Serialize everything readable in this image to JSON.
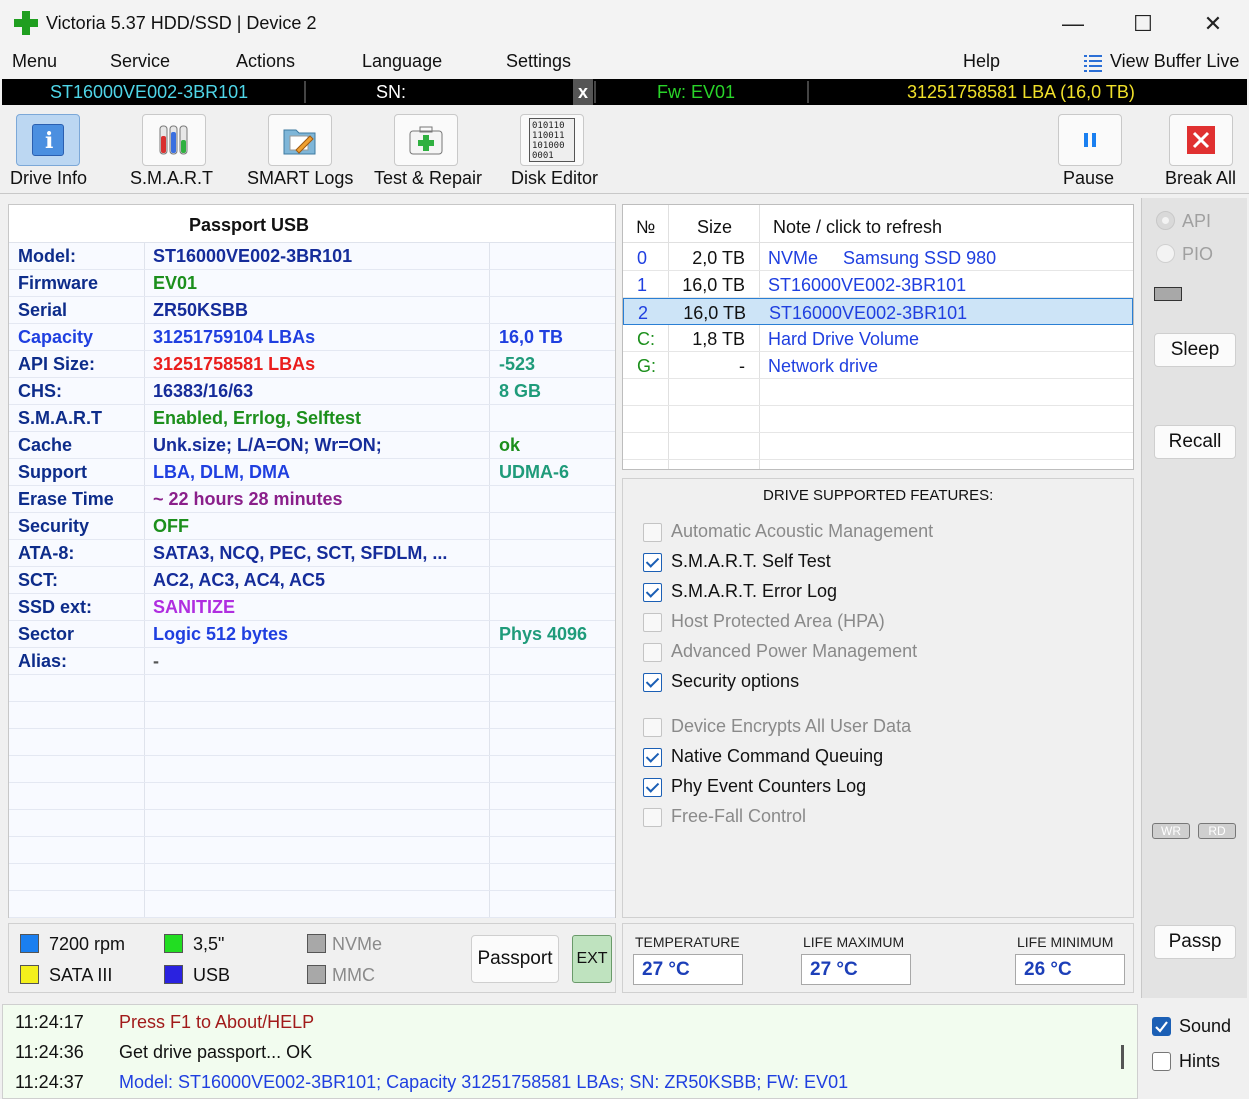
{
  "window": {
    "title": "Victoria 5.37 HDD/SSD | Device 2",
    "minimize": "—",
    "maximize": "☐",
    "close": "✕"
  },
  "menu": {
    "items": [
      "Menu",
      "Service",
      "Actions",
      "Language",
      "Settings",
      "Help"
    ],
    "view_buffer": "View Buffer Live"
  },
  "drive_strip": {
    "model": "ST16000VE002-3BR101",
    "sn_label": "SN:",
    "x_label": "x",
    "fw": "Fw: EV01",
    "lba": "31251758581 LBA (16,0 TB)",
    "colors": {
      "model": "#4fd6e8",
      "fw": "#29d429",
      "lba": "#f0e02a"
    }
  },
  "toolbar": {
    "drive_info": "Drive Info",
    "smart": "S.M.A.R.T",
    "smart_logs": "SMART Logs",
    "test_repair": "Test & Repair",
    "disk_editor": "Disk Editor",
    "pause": "Pause",
    "break_all": "Break All",
    "disk_editor_icon_text": "010110 110011 101000 0001"
  },
  "passport": {
    "header": "Passport USB",
    "rows": [
      {
        "key": "Model:",
        "value": "ST16000VE002-3BR101",
        "extra": "",
        "vcolor": "#152c9a",
        "xcolor": "#152c9a"
      },
      {
        "key": "Firmware",
        "value": "EV01",
        "extra": "",
        "vcolor": "#1c8f1c",
        "xcolor": "#152c9a"
      },
      {
        "key": "Serial",
        "value": "ZR50KSBB",
        "extra": "",
        "vcolor": "#152c9a",
        "xcolor": "#152c9a"
      },
      {
        "key": "Capacity",
        "value": "31251759104 LBAs",
        "extra": "16,0 TB",
        "vcolor": "#1f3fe0",
        "xcolor": "#1f3fe0",
        "kcolor": "#1f3fe0"
      },
      {
        "key": "API Size:",
        "value": "31251758581 LBAs",
        "extra": "-523",
        "vcolor": "#ea1d1d",
        "xcolor": "#1f9b7a"
      },
      {
        "key": "CHS:",
        "value": "16383/16/63",
        "extra": "8 GB",
        "vcolor": "#152c9a",
        "xcolor": "#1f9b7a"
      },
      {
        "key": "S.M.A.R.T",
        "value": "Enabled, Errlog, Selftest",
        "extra": "",
        "vcolor": "#1c8f1c",
        "xcolor": "#152c9a"
      },
      {
        "key": "Cache",
        "value": "Unk.size; L/A=ON; Wr=ON;",
        "extra": "ok",
        "vcolor": "#152c9a",
        "xcolor": "#1c8f1c"
      },
      {
        "key": "Support",
        "value": "LBA, DLM, DMA",
        "extra": "UDMA-6",
        "vcolor": "#1f3fe0",
        "xcolor": "#1f9b7a"
      },
      {
        "key": "Erase Time",
        "value": "~ 22 hours 28 minutes",
        "extra": "",
        "vcolor": "#8a1f8a",
        "xcolor": "#152c9a"
      },
      {
        "key": "Security",
        "value": "OFF",
        "extra": "",
        "vcolor": "#1c8f1c",
        "xcolor": "#152c9a"
      },
      {
        "key": "ATA-8:",
        "value": "SATA3, NCQ, PEC, SCT, SFDLM, ...",
        "extra": "",
        "vcolor": "#152c9a",
        "xcolor": "#152c9a"
      },
      {
        "key": "SCT:",
        "value": "AC2, AC3, AC4, AC5",
        "extra": "",
        "vcolor": "#152c9a",
        "xcolor": "#152c9a"
      },
      {
        "key": "SSD ext:",
        "value": "SANITIZE",
        "extra": "",
        "vcolor": "#b02ee0",
        "xcolor": "#152c9a"
      },
      {
        "key": "Sector",
        "value": "Logic 512 bytes",
        "extra": "Phys 4096",
        "vcolor": "#1f3fe0",
        "xcolor": "#1f9b7a"
      },
      {
        "key": "Alias:",
        "value": "-",
        "extra": "",
        "vcolor": "#555555",
        "xcolor": "#152c9a"
      }
    ]
  },
  "drives": {
    "headers": {
      "num": "№",
      "size": "Size",
      "note": "Note / click to refresh"
    },
    "rows": [
      {
        "num": "0",
        "size": "2,0 TB",
        "note": "NVMe     Samsung SSD 980",
        "numcolor": "#1f3fe0"
      },
      {
        "num": "1",
        "size": "16,0 TB",
        "note": "ST16000VE002-3BR101",
        "numcolor": "#1f3fe0"
      },
      {
        "num": "2",
        "size": "16,0 TB",
        "note": "ST16000VE002-3BR101",
        "numcolor": "#1f3fe0"
      },
      {
        "num": "C:",
        "size": "1,8 TB",
        "note": "Hard Drive Volume",
        "numcolor": "#1c8f1c"
      },
      {
        "num": "G:",
        "size": "-",
        "note": "Network drive",
        "numcolor": "#1c8f1c"
      }
    ]
  },
  "features": {
    "title": "DRIVE SUPPORTED FEATURES:",
    "items": [
      {
        "label": "Automatic Acoustic Management",
        "checked": false
      },
      {
        "label": "S.M.A.R.T. Self Test",
        "checked": true
      },
      {
        "label": "S.M.A.R.T. Error Log",
        "checked": true
      },
      {
        "label": "Host Protected Area (HPA)",
        "checked": false
      },
      {
        "label": "Advanced Power Management",
        "checked": false
      },
      {
        "label": "Security options",
        "checked": true
      },
      {
        "label": "Device Encrypts All User Data",
        "checked": false
      },
      {
        "label": "Native Command Queuing",
        "checked": true
      },
      {
        "label": "Phy Event Counters Log",
        "checked": true
      },
      {
        "label": "Free-Fall Control",
        "checked": false
      }
    ]
  },
  "side": {
    "api": "API",
    "pio": "PIO",
    "sleep": "Sleep",
    "recall": "Recall",
    "wr": "WR",
    "rd": "RD",
    "passp": "Passp",
    "sound": "Sound",
    "hints": "Hints",
    "sound_checked": true,
    "hints_checked": false
  },
  "legend": {
    "rpm": "7200 rpm",
    "form": "3,5\"",
    "nvme": "NVMe",
    "sata": "SATA III",
    "usb": "USB",
    "mmc": "MMC",
    "passport_button": "Passport",
    "ext_button": "EXT",
    "colors": {
      "rpm": "#1a7ff0",
      "form": "#22dd22",
      "nvme": "#a8a8a8",
      "sata": "#f4f01c",
      "usb": "#2a22e0",
      "mmc": "#a8a8a8"
    }
  },
  "temperature": {
    "temp_label": "TEMPERATURE",
    "temp_value": "27 °C",
    "life_max_label": "LIFE MAXIMUM",
    "life_max_value": "27 °C",
    "life_min_label": "LIFE MINIMUM",
    "life_min_value": "26 °C"
  },
  "log": [
    {
      "time": "11:24:17",
      "text": "Press F1 to About/HELP",
      "color": "#a11a1a"
    },
    {
      "time": "11:24:36",
      "text": "Get drive passport... OK",
      "color": "#111111"
    },
    {
      "time": "11:24:37",
      "text": "Model: ST16000VE002-3BR101; Capacity 31251758581 LBAs; SN: ZR50KSBB; FW: EV01",
      "color": "#1f3fe0"
    }
  ]
}
